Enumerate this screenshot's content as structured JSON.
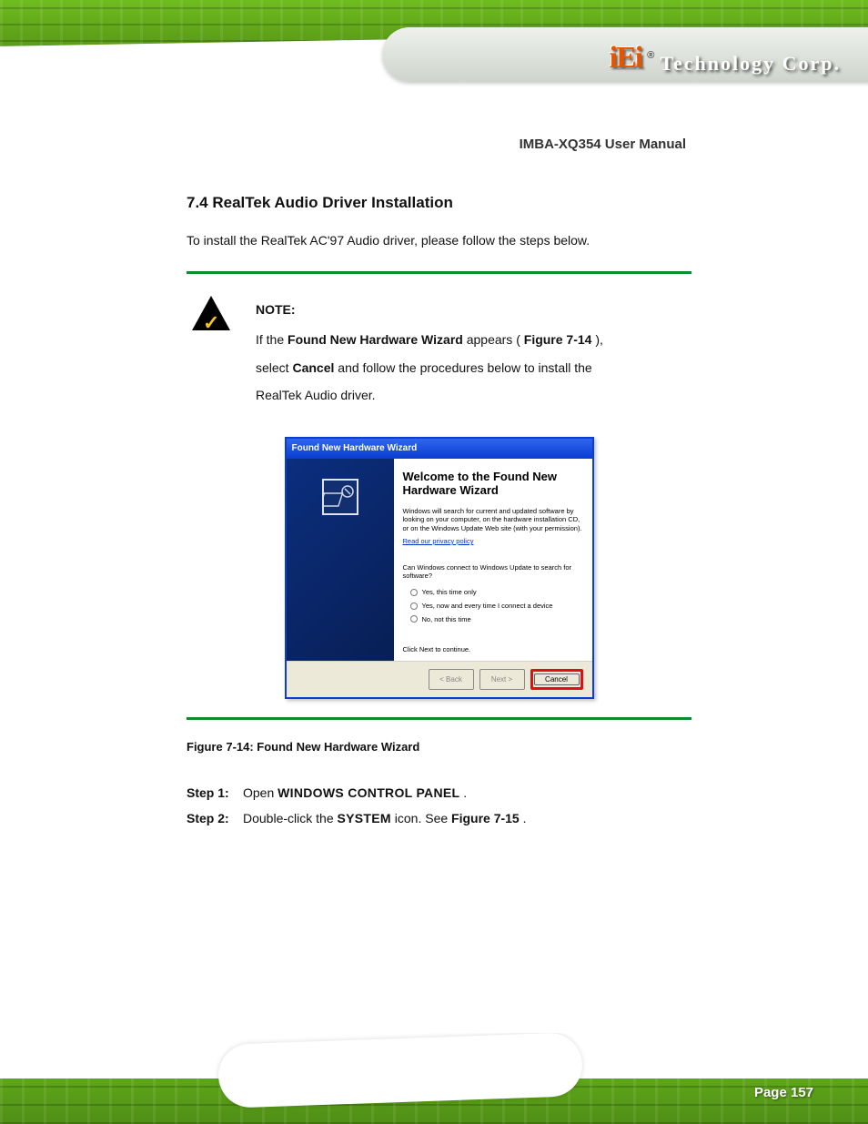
{
  "header": {
    "logo_text": "iEi",
    "registered": "®",
    "company": "Technology Corp."
  },
  "doc_title": {
    "prefix": "IMBA-XQ354 User Manual"
  },
  "section": {
    "heading": "7.4 RealTek Audio Driver Installation",
    "intro": "To install the RealTek AC'97 Audio driver, please follow the steps below."
  },
  "note": {
    "header": "NOTE:",
    "line1_pre": "If the ",
    "line1_em": "Found New Hardware Wizard",
    "line1_post": " appears (",
    "line1_fig": "Figure 7-14",
    "line1_close": "),",
    "line2_pre": "select ",
    "line2_em": "Cancel",
    "line2_post": " and follow the procedures below to install the",
    "line3": "RealTek Audio driver."
  },
  "wizard": {
    "title": "Found New Hardware Wizard",
    "heading": "Welcome to the Found New Hardware Wizard",
    "desc": "Windows will search for current and updated software by looking on your computer, on the hardware installation CD, or on the Windows Update Web site (with your permission).",
    "link": "Read our privacy policy",
    "question": "Can Windows connect to Windows Update to search for software?",
    "opt1": "Yes, this time only",
    "opt2": "Yes, now and every time I connect a device",
    "opt3": "No, not this time",
    "continue": "Click Next to continue.",
    "btn_back": "< Back",
    "btn_next": "Next >",
    "btn_cancel": "Cancel"
  },
  "figure_caption": "Figure 7-14: Found New Hardware Wizard",
  "steps": {
    "s1_num": "Step 1:",
    "s1_txt_a": "Open ",
    "s1_txt_b": "Windows Control Panel",
    "s1_txt_c": ".",
    "s2_num": "Step 2:",
    "s2_txt_a": "Double-click the ",
    "s2_txt_b": "System",
    "s2_txt_c": " icon. See ",
    "s2_txt_d": "Figure 7-15",
    "s2_txt_e": "."
  },
  "footer": {
    "page": "Page 157"
  }
}
